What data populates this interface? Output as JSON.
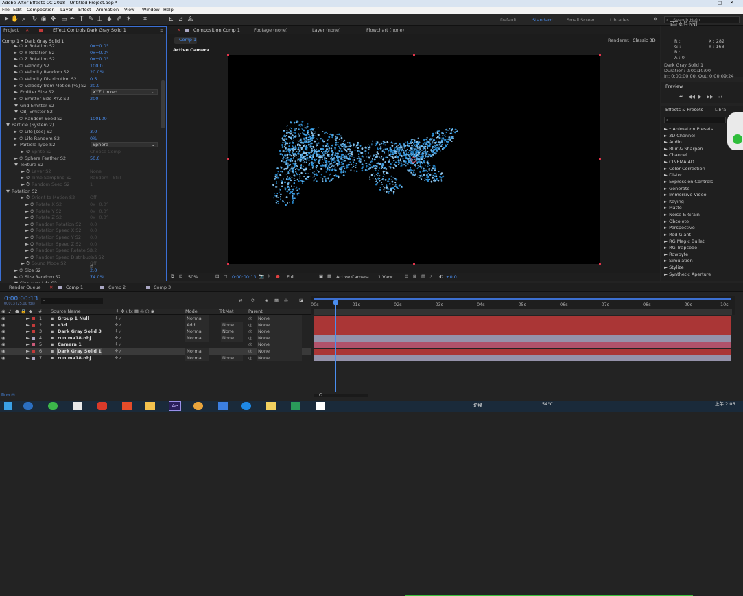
{
  "titlebar": {
    "title": "Adobe After Effects CC 2018 - Untitled Project.aep *"
  },
  "menu": [
    "File",
    "Edit",
    "Composition",
    "Layer",
    "Effect",
    "Animation",
    "View",
    "Window",
    "Help"
  ],
  "workspaces": [
    "Default",
    "Standard",
    "Small Screen",
    "Libraries"
  ],
  "search_placeholder": "Search Help",
  "watermark": "直线网",
  "ecp": {
    "tab_project": "Project",
    "tab_effect": "Effect Controls Dark Gray Solid 1",
    "subtitle": "Comp 1 • Dark Gray Solid 1",
    "rows": [
      {
        "n": "X Rotation S2",
        "v": "0x+0.0°"
      },
      {
        "n": "Y Rotation S2",
        "v": "0x+0.0°"
      },
      {
        "n": "Z Rotation S2",
        "v": "0x+0.0°"
      },
      {
        "n": "Velocity S2",
        "v": "100.0"
      },
      {
        "n": "Velocity Random S2",
        "v": "20.0%"
      },
      {
        "n": "Velocity Distribution S2",
        "v": "0.5"
      },
      {
        "n": "Velocity from Motion [%] S2",
        "v": "20.0"
      },
      {
        "n": "Emitter Size S2",
        "v": "XYZ Linked",
        "dd": true
      },
      {
        "n": "Emitter Size XYZ S2",
        "v": "200"
      },
      {
        "n": "Grid Emitter S2",
        "v": ""
      },
      {
        "n": "OBJ Emitter S2",
        "v": ""
      },
      {
        "n": "Random Seed S2",
        "v": "100100"
      },
      {
        "n": "Particle (System 2)",
        "v": ""
      },
      {
        "n": "Life [sec] S2",
        "v": "3.0"
      },
      {
        "n": "Life Random S2",
        "v": "0%"
      },
      {
        "n": "Particle Type S2",
        "v": "Sphere",
        "dd": true
      },
      {
        "n": "Sprite S2",
        "v": "Choose Comp",
        "dim": true
      },
      {
        "n": "Sphere Feather S2",
        "v": "50.0"
      },
      {
        "n": "Texture S2",
        "v": ""
      },
      {
        "n": "Layer S2",
        "v": "None",
        "dim": true
      },
      {
        "n": "Time Sampling S2",
        "v": "Random - Still",
        "dim": true
      },
      {
        "n": "Random Seed S2",
        "v": "1",
        "dim": true
      },
      {
        "n": "Rotation S2",
        "v": ""
      },
      {
        "n": "Orient to Motion S2",
        "v": "Off",
        "dim": true
      },
      {
        "n": "Rotate X S2",
        "v": "0x+0.0°",
        "dim": true
      },
      {
        "n": "Rotate Y S2",
        "v": "0x+0.0°",
        "dim": true
      },
      {
        "n": "Rotate Z S2",
        "v": "0x+0.0°",
        "dim": true
      },
      {
        "n": "Random Rotation S2",
        "v": "0.0",
        "dim": true
      },
      {
        "n": "Rotation Speed X S2",
        "v": "0.0",
        "dim": true
      },
      {
        "n": "Rotation Speed Y S2",
        "v": "0.0",
        "dim": true
      },
      {
        "n": "Rotation Speed Z S2",
        "v": "0.0",
        "dim": true
      },
      {
        "n": "Random Speed Rotate S2",
        "v": "0.2",
        "dim": true
      },
      {
        "n": "Random Speed Distribution S2",
        "v": "0.5",
        "dim": true
      },
      {
        "n": "Sound Mode S2",
        "v": "Off",
        "dim": true
      },
      {
        "n": "Size S2",
        "v": "2.0"
      },
      {
        "n": "Size Random S2",
        "v": "74.0%"
      },
      {
        "n": "Size over Life S2",
        "v": ""
      }
    ]
  },
  "comp_tabs": [
    "Composition Comp 1",
    "Footage (none)",
    "Layer (none)",
    "Flowchart (none)"
  ],
  "comp_sub": "Comp 1",
  "renderer_label": "Renderer:",
  "renderer": "Classic 3D",
  "active_camera": "Active Camera",
  "viewer_bar": {
    "zoom": "50%",
    "timecode": "0:00:00:13",
    "resolution": "Full",
    "view": "Active Camera",
    "views": "1 View",
    "exposure": "+0.0"
  },
  "info": {
    "rows": [
      "R :",
      "G :",
      "B :",
      "A : 0"
    ],
    "x": "X : 282",
    "y": "Y : 168",
    "layer": "Dark Gray Solid 1",
    "duration": "Duration: 0:00:10:00",
    "inout": "In: 0:00:00:00, Out: 0:00:09:24"
  },
  "preview_label": "Preview",
  "effects_tab": "Effects & Presets",
  "libraries_tab": "Libra",
  "effects": [
    "* Animation Presets",
    "3D Channel",
    "Audio",
    "Blur & Sharpen",
    "Channel",
    "CINEMA 4D",
    "Color Correction",
    "Distort",
    "Expression Controls",
    "Generate",
    "Immersive Video",
    "Keying",
    "Matte",
    "Noise & Grain",
    "Obsolete",
    "Perspective",
    "Red Giant",
    "RG Magic Bullet",
    "RG Trapcode",
    "Rowbyte",
    "Simulation",
    "Stylize",
    "Synthetic Aperture"
  ],
  "timeline": {
    "tabs": [
      "Render Queue",
      "Comp 1",
      "Comp 2",
      "Comp 3"
    ],
    "timecode": "0:00:00:13",
    "fps": "00013 (25.00 fps)",
    "col_source": "Source Name",
    "col_mode": "Mode",
    "col_trkmat": "TrkMat",
    "col_parent": "Parent",
    "layers": [
      {
        "n": "1",
        "name": "Group 1 Null",
        "mode": "Normal",
        "trk": "",
        "parent": "None",
        "color": "#c23a3a"
      },
      {
        "n": "2",
        "name": "e3d",
        "mode": "Add",
        "trk": "None",
        "parent": "None",
        "color": "#c23a3a"
      },
      {
        "n": "3",
        "name": "Dark Gray Solid 3",
        "mode": "Normal",
        "trk": "None",
        "parent": "None",
        "color": "#c23a3a"
      },
      {
        "n": "4",
        "name": "run ma18.obj",
        "mode": "Normal",
        "trk": "None",
        "parent": "None",
        "color": "#a9a6c2"
      },
      {
        "n": "5",
        "name": "Camera 1",
        "mode": "",
        "trk": "",
        "parent": "None",
        "color": "#c95a78"
      },
      {
        "n": "6",
        "name": "Dark Gray Solid 1",
        "mode": "Normal",
        "trk": "",
        "parent": "None",
        "color": "#c23a3a"
      },
      {
        "n": "7",
        "name": "run ma18.obj",
        "mode": "Normal",
        "trk": "None",
        "parent": "None",
        "color": "#a9a6c2"
      }
    ],
    "ruler": [
      "00s",
      "01s",
      "02s",
      "03s",
      "04s",
      "05s",
      "06s",
      "07s",
      "08s",
      "09s",
      "10s"
    ],
    "playhead": 0.052
  },
  "taskbar": {
    "weather": "54°C",
    "ime": "切换",
    "clock": "上午 2:06"
  }
}
